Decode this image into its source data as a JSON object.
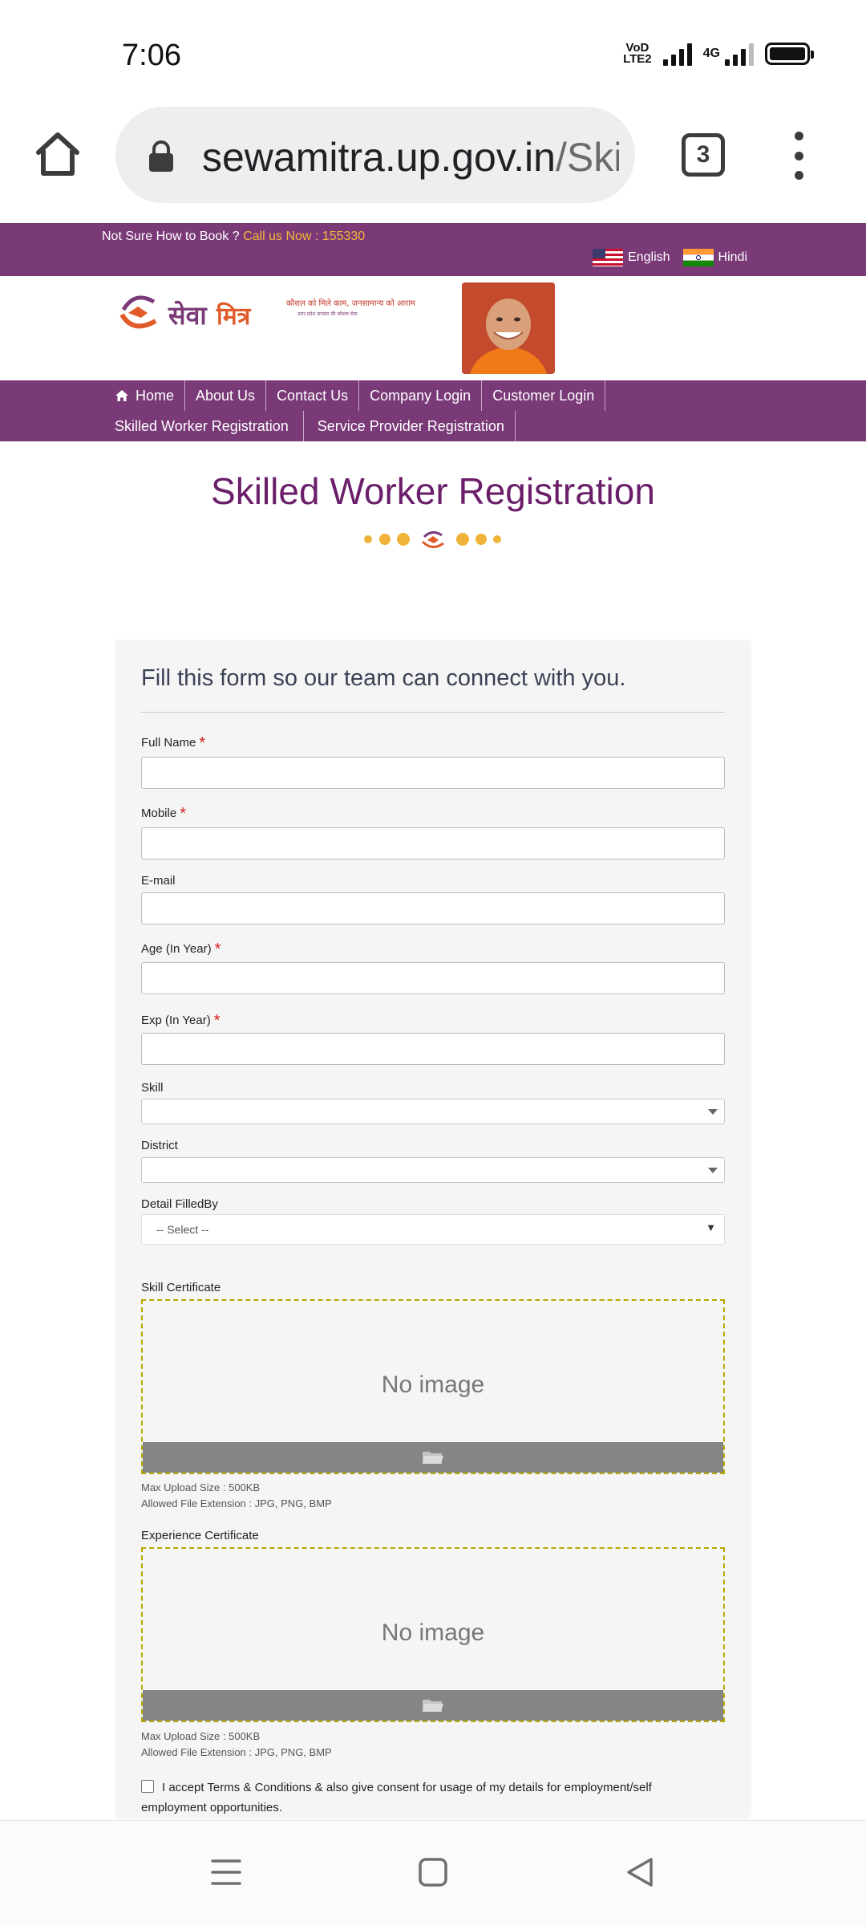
{
  "status_bar": {
    "time": "7:06",
    "volte": "VoD\nLTE2",
    "network": "4G"
  },
  "browser": {
    "url_host": "sewamitra.up.gov.in",
    "url_path": "/Ski",
    "tab_count": "3"
  },
  "site_header": {
    "help_text": "Not Sure How to Book ?",
    "call_text": "Call us Now : 155330",
    "languages": [
      "English",
      "Hindi"
    ]
  },
  "nav": {
    "items": [
      "Home",
      "About Us",
      "Contact Us",
      "Company Login",
      "Customer Login",
      "Skilled Worker Registration",
      "Service Provider Registration"
    ]
  },
  "page": {
    "title": "Skilled Worker Registration"
  },
  "form": {
    "intro": "Fill this form so our team can connect with you.",
    "fields": {
      "full_name": "Full Name",
      "mobile": "Mobile",
      "email": "E-mail",
      "age": "Age (In Year)",
      "exp": "Exp (In Year)",
      "skill": "Skill",
      "district": "District",
      "filled_by": "Detail FilledBy",
      "filled_by_value": "-- Select --",
      "required_mark": "*"
    },
    "skill_certificate": {
      "label": "Skill Certificate",
      "placeholder": "No image",
      "max_size": "Max Upload Size : 500KB",
      "extensions": "Allowed File Extension : JPG, PNG, BMP"
    },
    "experience_certificate": {
      "label": "Experience Certificate",
      "placeholder": "No image",
      "max_size": "Max Upload Size : 500KB",
      "extensions": "Allowed File Extension : JPG, PNG, BMP"
    },
    "consent": "I accept Terms & Conditions & also give consent for usage of my details for employment/self employment opportunities."
  },
  "colors": {
    "brand_purple": "#7a3a78",
    "title_purple": "#6b1f6a",
    "accent_orange": "#f6b53a"
  }
}
